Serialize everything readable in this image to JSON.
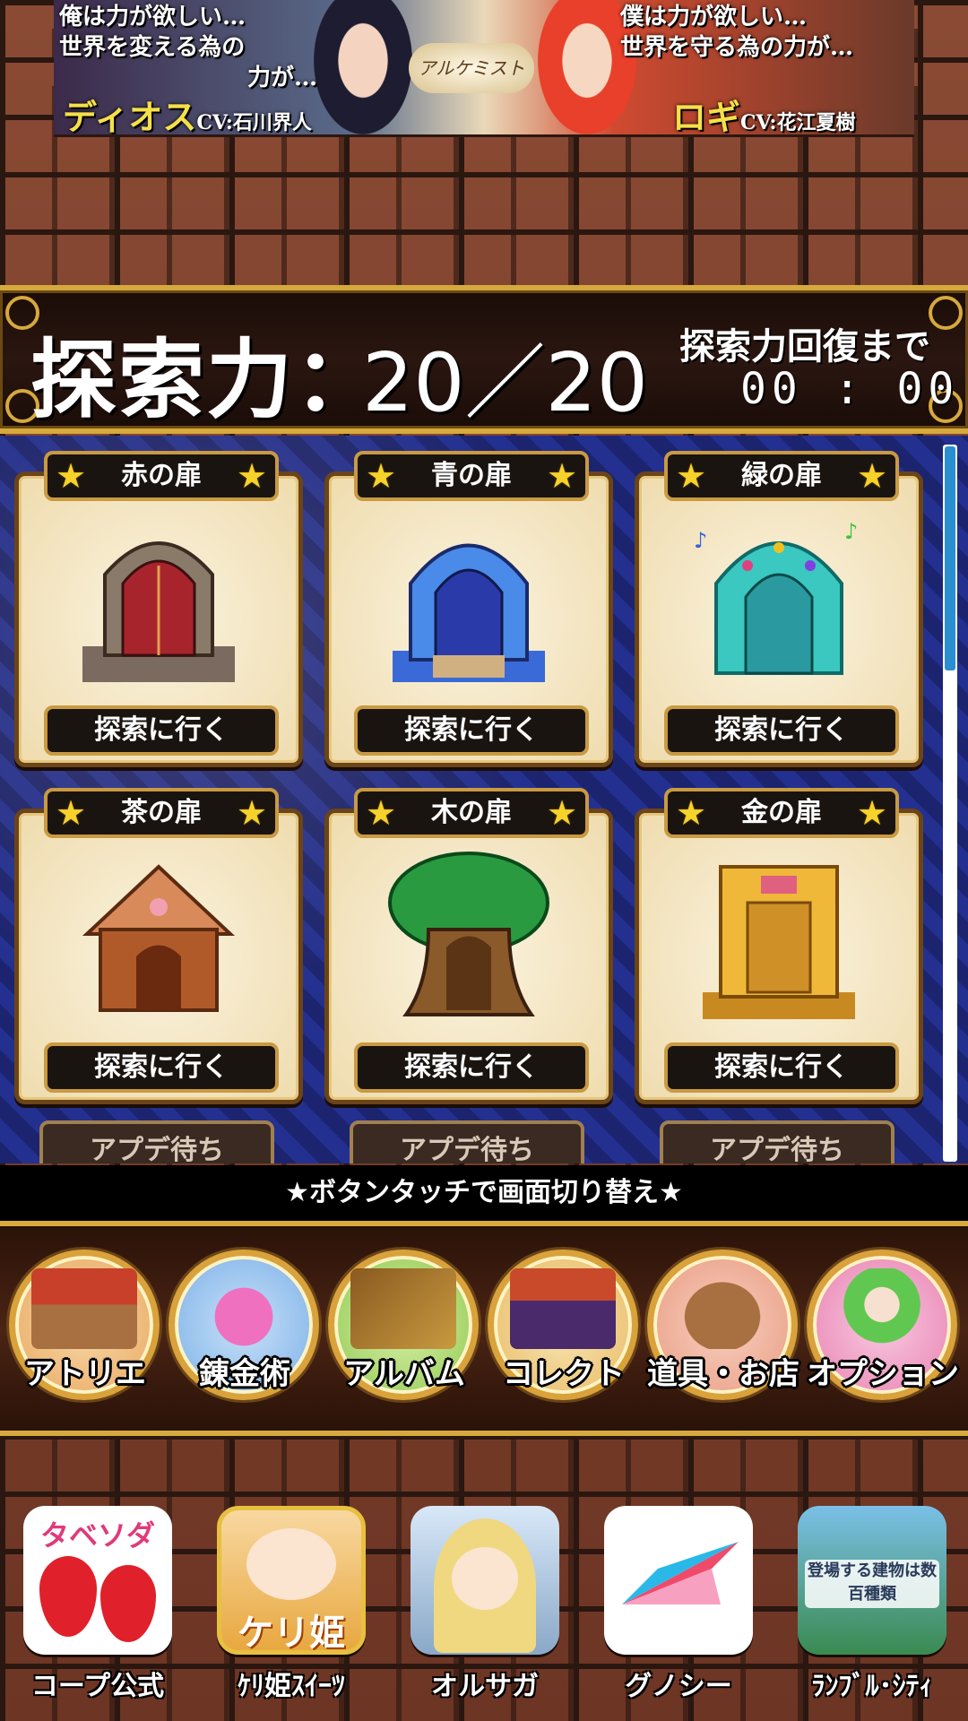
{
  "banner": {
    "left_line1": "俺は力が欲しい…",
    "left_line2": "世界を変える為の",
    "left_line3": "力が…",
    "left_name": "ディオス",
    "left_cv": "CV:石川界人",
    "right_line1": "僕は力が欲しい…",
    "right_line2": "世界を守る為の力が…",
    "right_name": "ロギ",
    "right_cv": "CV:花江夏樹",
    "logo": "アルケミスト"
  },
  "power": {
    "label": "探索力：",
    "current": "20",
    "separator": "／",
    "max": "20",
    "recover_label": "探索力回復まで",
    "timer": "00 : 00"
  },
  "doors": [
    {
      "name": "赤の扉",
      "button": "探索に行く",
      "icon": "red-arch-door-icon",
      "color": "#a8242c"
    },
    {
      "name": "青の扉",
      "button": "探索に行く",
      "icon": "blue-arch-door-icon",
      "color": "#2a50c8"
    },
    {
      "name": "緑の扉",
      "button": "探索に行く",
      "icon": "teal-music-door-icon",
      "color": "#2cb8b0"
    },
    {
      "name": "茶の扉",
      "button": "探索に行く",
      "icon": "gingerbread-house-door-icon",
      "color": "#b05a2a"
    },
    {
      "name": "木の扉",
      "button": "探索に行く",
      "icon": "tree-door-icon",
      "color": "#7a4a20"
    },
    {
      "name": "金の扉",
      "button": "探索に行く",
      "icon": "gold-door-icon",
      "color": "#e2a52a"
    }
  ],
  "pending": [
    "アプデ待ち",
    "アプデ待ち",
    "アプデ待ち"
  ],
  "hint": "★ボタンタッチで画面切り替え★",
  "menu": [
    {
      "label": "アトリエ",
      "icon": "atelier-house-icon"
    },
    {
      "label": "錬金術",
      "icon": "potion-icon"
    },
    {
      "label": "アルバム",
      "icon": "album-book-icon"
    },
    {
      "label": "コレクト",
      "icon": "treasure-chest-icon"
    },
    {
      "label": "道具・お店",
      "icon": "item-bag-icon"
    },
    {
      "label": "オプション",
      "icon": "option-fairy-icon"
    }
  ],
  "apps": [
    {
      "name": "コープ公式",
      "icon_text": "タベソダ"
    },
    {
      "name": "ｹﾘ姫ｽｲｰﾂ",
      "icon_text": "ケリ姫"
    },
    {
      "name": "オルサガ",
      "icon_text": ""
    },
    {
      "name": "グノシー",
      "icon_text": ""
    },
    {
      "name": "ﾗﾝﾌﾞﾙ･ｼﾃｨ",
      "icon_text": "登場する建物は数百種類"
    }
  ]
}
